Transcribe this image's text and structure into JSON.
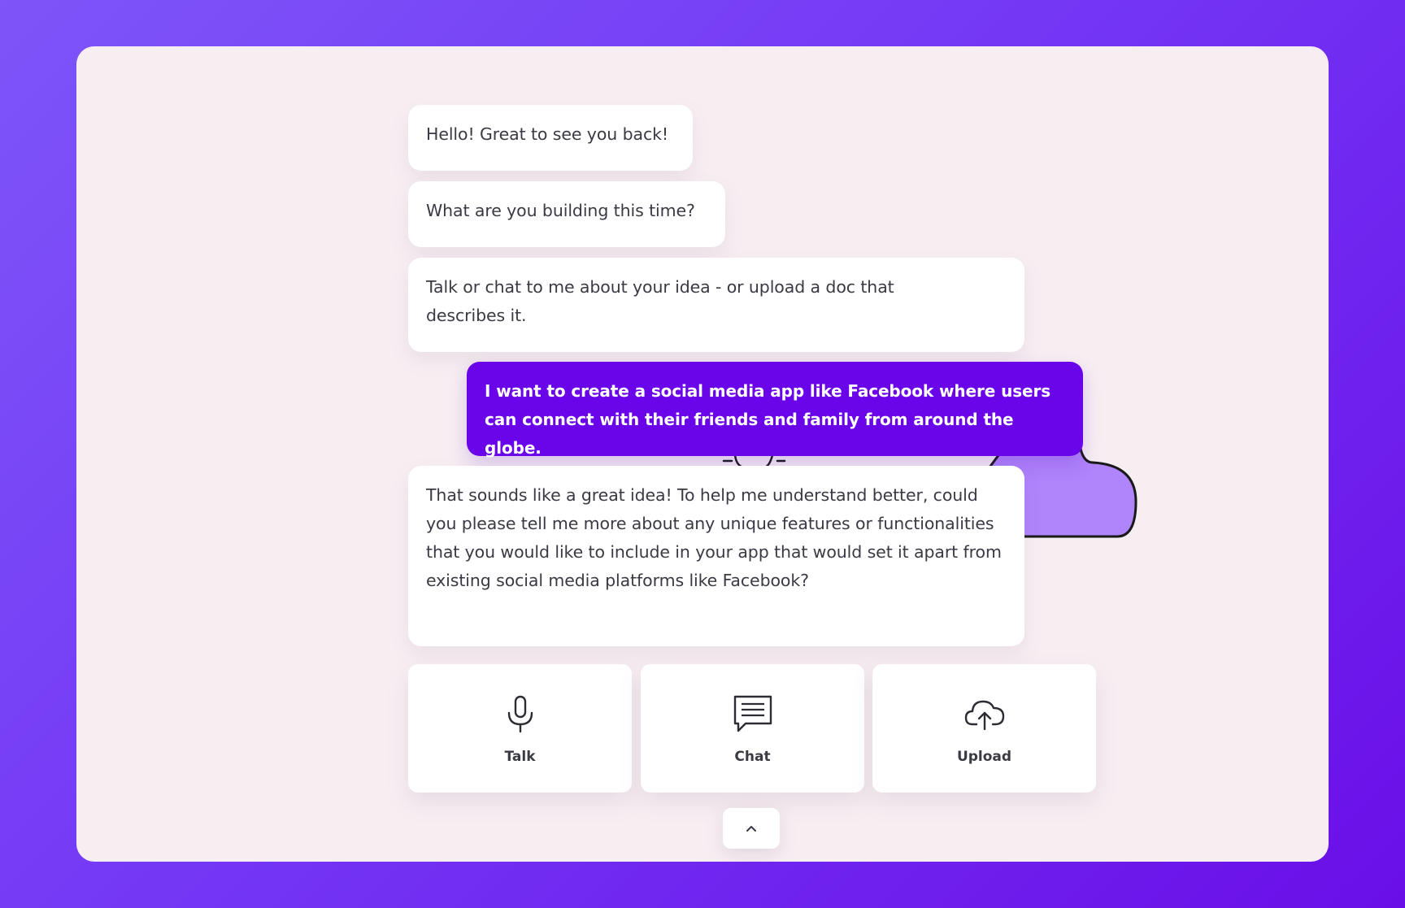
{
  "messages": [
    {
      "role": "assistant",
      "text": "Hello! Great to see you back!"
    },
    {
      "role": "assistant",
      "text": "What are you building this time?"
    },
    {
      "role": "assistant",
      "text": "Talk or chat to me about your idea - or upload a doc that describes it."
    },
    {
      "role": "user",
      "text": "I want to create a social media app like Facebook where users can connect with their friends and family from around the globe."
    },
    {
      "role": "assistant",
      "text": "That sounds like a great idea! To help me understand better, could you please tell me more about any unique features or functionalities that you would like to include in your app that would set it apart from existing social media platforms like Facebook?"
    }
  ],
  "actions": {
    "talk": {
      "label": "Talk",
      "icon": "microphone-icon"
    },
    "chat": {
      "label": "Chat",
      "icon": "chat-bubble-icon"
    },
    "upload": {
      "label": "Upload",
      "icon": "cloud-upload-icon"
    }
  },
  "collapse": {
    "icon": "chevron-up-icon"
  },
  "colors": {
    "background_gradient": [
      "#7e55f8",
      "#6a0ee8"
    ],
    "card": "#f7eef2",
    "user_bubble": "#6a05ea",
    "cloud_decoration": "#b084fb"
  }
}
